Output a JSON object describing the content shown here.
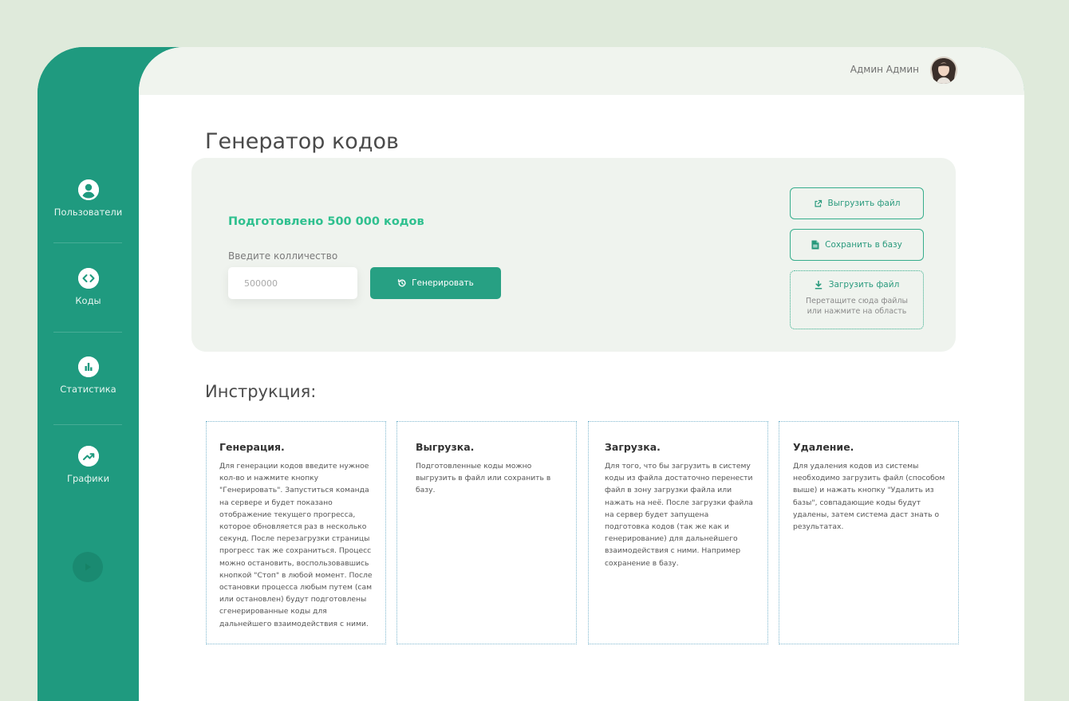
{
  "sidebar": {
    "items": [
      {
        "label": "Пользователи",
        "icon": "user-icon"
      },
      {
        "label": "Коды",
        "icon": "code-icon"
      },
      {
        "label": "Статистика",
        "icon": "bar-chart-icon"
      },
      {
        "label": "Графики",
        "icon": "trend-chart-icon"
      }
    ]
  },
  "header": {
    "user_name": "Админ Админ"
  },
  "page": {
    "title": "Генератор кодов"
  },
  "generator": {
    "prepared_text": "Подготовлено 500 000 кодов",
    "quantity_label": "Введите колличество",
    "quantity_placeholder": "500000",
    "generate_label": "Генерировать",
    "export_label": "Выгрузить файл",
    "save_label": "Сохранить в базу",
    "upload_label": "Загрузить файл",
    "upload_hint_line1": "Перетащите сюда файлы",
    "upload_hint_line2": "или нажмите на область"
  },
  "instructions": {
    "title": "Инструкция:",
    "cards": [
      {
        "title": "Генерация.",
        "text": "Для генерации кодов введите нужное кол-во и нажмите кнопку \"Генерировать\". Запуститься команда на сервере и будет показано отображение текущего прогресса, которое обновляется раз в несколько секунд. После перезагрузки страницы прогресс так же сохраниться. Процесс можно остановить, воспользовавшись кнопкой \"Стоп\" в любой момент. После остановки процесса любым путем (сам или остановлен) будут подготовлены сгенерированные коды для дальнейшего взаимодействия с ними."
      },
      {
        "title": "Выгрузка.",
        "text": "Подготовленные коды можно выгрузить в файл или сохранить в базу."
      },
      {
        "title": "Загрузка.",
        "text": "Для того, что бы загрузить в систему коды из файла достаточно перенести файл в зону загрузки файла или нажать на неё. После загрузки файла на сервер будет запущена подготовка кодов (так же как и генерирование) для дальнейшего взаимодействия с ними. Например сохранение в базу."
      },
      {
        "title": "Удаление.",
        "text": "Для удаления кодов из системы необходимо загрузить файл (способом выше) и нажать кнопку \"Удалить из базы\", совпадающие коды будут удалены, затем система даст знать о результатах."
      }
    ]
  },
  "colors": {
    "accent": "#1f9a7f",
    "highlight": "#2fc08f",
    "background": "#dfeadb"
  }
}
